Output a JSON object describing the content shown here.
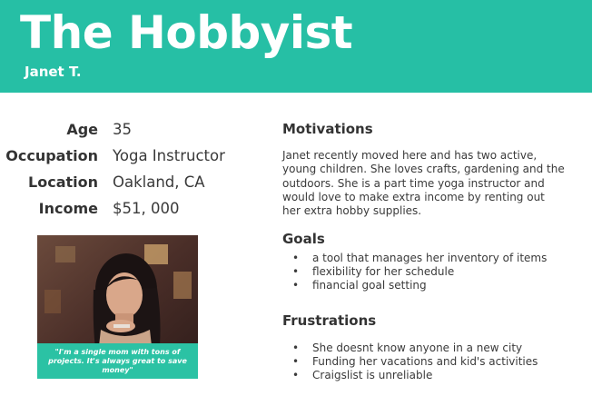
{
  "header": {
    "title": "The Hobbyist",
    "subtitle": "Janet T."
  },
  "facts": [
    {
      "label": "Age",
      "value": "35"
    },
    {
      "label": "Occupation",
      "value": "Yoga Instructor"
    },
    {
      "label": "Location",
      "value": "Oakland, CA"
    },
    {
      "label": "Income",
      "value": "$51, 000"
    }
  ],
  "quote": "\"I'm a single mom with tons of projects. It's always great to save money\"",
  "motivations": {
    "title": "Motivations",
    "text": "Janet recently moved here and has two active, young children. She loves crafts, gardening and the outdoors. She is a part time yoga instructor and would love to make extra income by renting out her extra hobby supplies."
  },
  "goals": {
    "title": "Goals",
    "items": [
      "a tool that manages her inventory of items",
      "flexibility for her schedule",
      "financial goal setting"
    ]
  },
  "frustrations": {
    "title": "Frustrations",
    "items": [
      "She doesnt know anyone in a new city",
      "Funding her vacations and kid's activities",
      "Craigslist is unreliable"
    ]
  },
  "colors": {
    "accent": "#26bfa5"
  },
  "photo_icon": "person-photo"
}
